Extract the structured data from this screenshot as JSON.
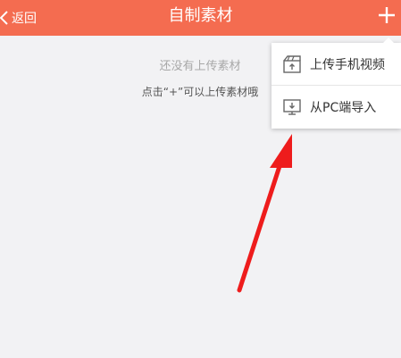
{
  "header": {
    "back_label": "返回",
    "title": "自制素材"
  },
  "empty_state": {
    "title": "还没有上传素材",
    "hint": "点击“+”可以上传素材哦"
  },
  "popup_menu": {
    "items": [
      {
        "label": "上传手机视频",
        "icon": "upload-video-icon"
      },
      {
        "label": "从PC端导入",
        "icon": "pc-import-icon"
      }
    ]
  },
  "colors": {
    "header_bg": "#f46c50",
    "page_bg": "#f2f2f4",
    "annotation_arrow": "#ee1c1c"
  }
}
